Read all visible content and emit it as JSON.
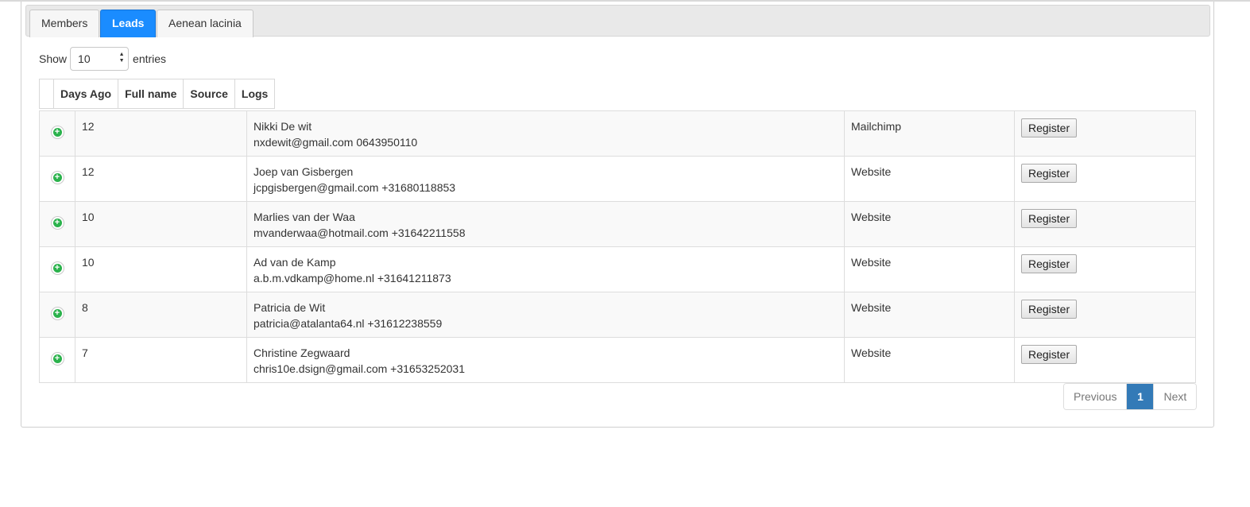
{
  "tabs": [
    {
      "label": "Members",
      "active": false
    },
    {
      "label": "Leads",
      "active": true
    },
    {
      "label": "Aenean lacinia",
      "active": false
    }
  ],
  "length_control": {
    "show_label": "Show",
    "selected": "10",
    "entries_label": "entries"
  },
  "table": {
    "headers": [
      "Days Ago",
      "Full name",
      "Source",
      "Logs"
    ],
    "rows": [
      {
        "days_ago": "12",
        "name": "Nikki De wit",
        "contact": "nxdewit@gmail.com 0643950110",
        "source": "Mailchimp",
        "action": "Register"
      },
      {
        "days_ago": "12",
        "name": "Joep van Gisbergen",
        "contact": "jcpgisbergen@gmail.com +31680118853",
        "source": "Website",
        "action": "Register"
      },
      {
        "days_ago": "10",
        "name": "Marlies van der Waa",
        "contact": "mvanderwaa@hotmail.com +31642211558",
        "source": "Website",
        "action": "Register"
      },
      {
        "days_ago": "10",
        "name": "Ad van de Kamp",
        "contact": "a.b.m.vdkamp@home.nl +31641211873",
        "source": "Website",
        "action": "Register"
      },
      {
        "days_ago": "8",
        "name": "Patricia de Wit",
        "contact": "patricia@atalanta64.nl +31612238559",
        "source": "Website",
        "action": "Register"
      },
      {
        "days_ago": "7",
        "name": "Christine Zegwaard",
        "contact": "chris10e.dsign@gmail.com +31653252031",
        "source": "Website",
        "action": "Register"
      }
    ]
  },
  "pagination": {
    "previous": "Previous",
    "current": "1",
    "next": "Next"
  },
  "icons": {
    "expand": "plus-circle-icon",
    "select": "sort-arrows-icon"
  },
  "colors": {
    "active_tab": "#1a8cff",
    "current_page": "#337ab7",
    "expand_icon": "#2bb24c"
  }
}
